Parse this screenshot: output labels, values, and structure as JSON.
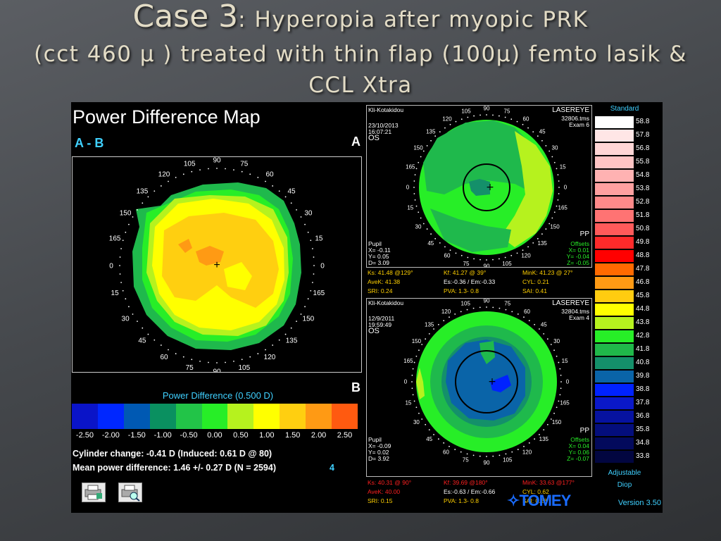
{
  "slide": {
    "case_label": "Case 3",
    "title_rest": ": Hyperopia after myopic PRK",
    "line2": "(cct 460 μ ) treated with thin flap (100μ) femto lasik &",
    "line3": "CCL Xtra"
  },
  "left": {
    "title": "Power Difference Map",
    "ab_label": "A - B",
    "label_a": "A",
    "label_b": "B",
    "angles": [
      "90",
      "105",
      "120",
      "135",
      "150",
      "165",
      "0",
      "15",
      "30",
      "45",
      "60",
      "75",
      "90",
      "105",
      "120",
      "135",
      "150",
      "165",
      "0",
      "15",
      "30",
      "45",
      "60",
      "75"
    ],
    "legend_title": "Power Difference (0.500 D)",
    "legend_ticks": [
      "-2.50",
      "-2.00",
      "-1.50",
      "-1.00",
      "-0.50",
      "0.00",
      "0.50",
      "1.00",
      "1.50",
      "2.00",
      "2.50"
    ],
    "legend_colors": [
      "#0a14c8",
      "#0027ff",
      "#0059b3",
      "#0a9060",
      "#22c448",
      "#27ee27",
      "#b6f21e",
      "#ffff00",
      "#ffcf10",
      "#ff9a14",
      "#ff5a10"
    ],
    "stat_cyl": "Cylinder change: -0.41 D (Induced:  0.61 D @  80)",
    "stat_mean": "Mean power difference:  1.46 +/-  0.27 D (N = 2594)",
    "stat_n": "4"
  },
  "map_a": {
    "name": "Kli-Kotakidou",
    "date": "23/10/2013",
    "time": "16:07:21",
    "eye": "OS",
    "device": "LASEREYE",
    "file": "32806.tms",
    "exam": "Exam 6",
    "pp": "PP",
    "pupil": "Pupil",
    "pupil_x": "X= -0.11",
    "pupil_y": "Y=  0.05",
    "pupil_d": "D=  3.09",
    "offsets": "Offsets",
    "off_x": "X=  0.01",
    "off_y": "Y= -0.04",
    "off_z": "Z= -0.05",
    "ks": "Ks: 41.48 @129°",
    "kf": "Kf: 41.27 @ 39°",
    "mink": "MinK: 41.23 @ 27°",
    "avek": "AveK: 41.38",
    "es": "Es:-0.36 / Em:-0.33",
    "cyl": "CYL:  0.21",
    "sri": "SRI:  0.24",
    "pva": "PVA:  1.3-  0.8",
    "sai": "SAI:  0.41"
  },
  "map_b": {
    "name": "Kli-Kotakidou",
    "date": "12/9/2011",
    "time": "19:59:49",
    "eye": "OS",
    "device": "LASEREYE",
    "file": "32804.tms",
    "exam": "Exam 4",
    "pp": "PP",
    "pupil": "Pupil",
    "pupil_x": "X= -0.09",
    "pupil_y": "Y=  0.02",
    "pupil_d": "D=  3.92",
    "offsets": "Offsets",
    "off_x": "X=  0.04",
    "off_y": "Y=  0.06",
    "off_z": "Z= -0.07",
    "ks": "Ks: 40.31 @ 90°",
    "kf": "Kf: 39.69 @180°",
    "mink": "MinK: 33.63 @177°",
    "avek": "AveK: 40.00",
    "es": "Es:-0.63 / Em:-0.66",
    "cyl": "CYL:  0.62",
    "sri": "SRI:  0.15",
    "pva": "PVA:  1.3-  0.8",
    "sai": "SAI:  0.28"
  },
  "scale": {
    "header": "Standard",
    "values": [
      "58.8",
      "57.8",
      "56.8",
      "55.8",
      "54.8",
      "53.8",
      "52.8",
      "51.8",
      "50.8",
      "49.8",
      "48.8",
      "47.8",
      "46.8",
      "45.8",
      "44.8",
      "43.8",
      "42.8",
      "41.8",
      "40.8",
      "39.8",
      "38.8",
      "37.8",
      "36.8",
      "35.8",
      "34.8",
      "33.8"
    ],
    "colors": [
      "#ffffff",
      "#ffe6e6",
      "#ffd6d6",
      "#ffc4c4",
      "#ffb2b2",
      "#ffa0a0",
      "#ff8a8a",
      "#ff7373",
      "#ff5a5a",
      "#ff2a2a",
      "#ff0000",
      "#ff6a00",
      "#ff9a14",
      "#ffcc10",
      "#ffff00",
      "#b6f21e",
      "#27ee27",
      "#20b84a",
      "#14906a",
      "#0a64a8",
      "#0022ff",
      "#0a18c8",
      "#0612a0",
      "#040e7c",
      "#030a5c",
      "#020640"
    ],
    "adjustable": "Adjustable",
    "diop": "Diop",
    "version": "Version 3.50"
  },
  "brand": "TOMEY"
}
